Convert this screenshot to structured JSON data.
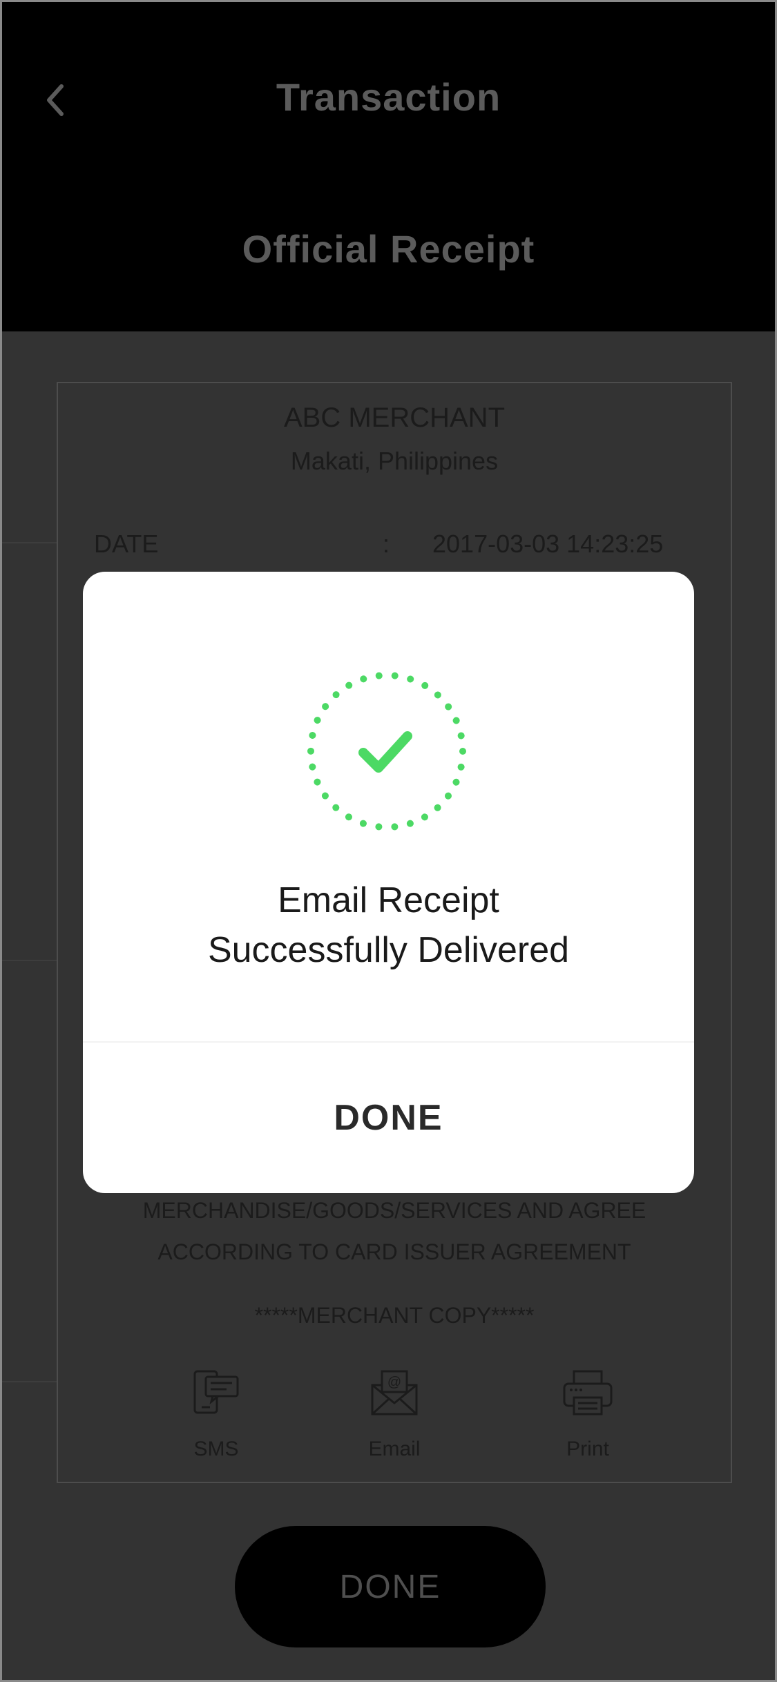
{
  "header": {
    "title": "Transaction",
    "subtitle": "Official Receipt"
  },
  "receipt": {
    "merchant_name": "ABC MERCHANT",
    "location": "Makati, Philippines",
    "date_label": "DATE",
    "date_separator": ":",
    "date_value": "2017-03-03  14:23:25",
    "agreement_line1": "MERCHANDISE/GOODS/SERVICES AND AGREE",
    "agreement_line2": "ACCORDING TO CARD ISSUER AGREEMENT",
    "copy_label": "*****MERCHANT COPY*****",
    "actions": [
      {
        "label": "SMS",
        "icon": "sms-icon"
      },
      {
        "label": "Email",
        "icon": "email-icon"
      },
      {
        "label": "Print",
        "icon": "print-icon"
      }
    ]
  },
  "bottom": {
    "done_label": "DONE"
  },
  "modal": {
    "message_line1": "Email Receipt",
    "message_line2": "Successfully Delivered",
    "done_label": "DONE",
    "accent_color": "#4cd964",
    "icon": "success-check-icon"
  }
}
